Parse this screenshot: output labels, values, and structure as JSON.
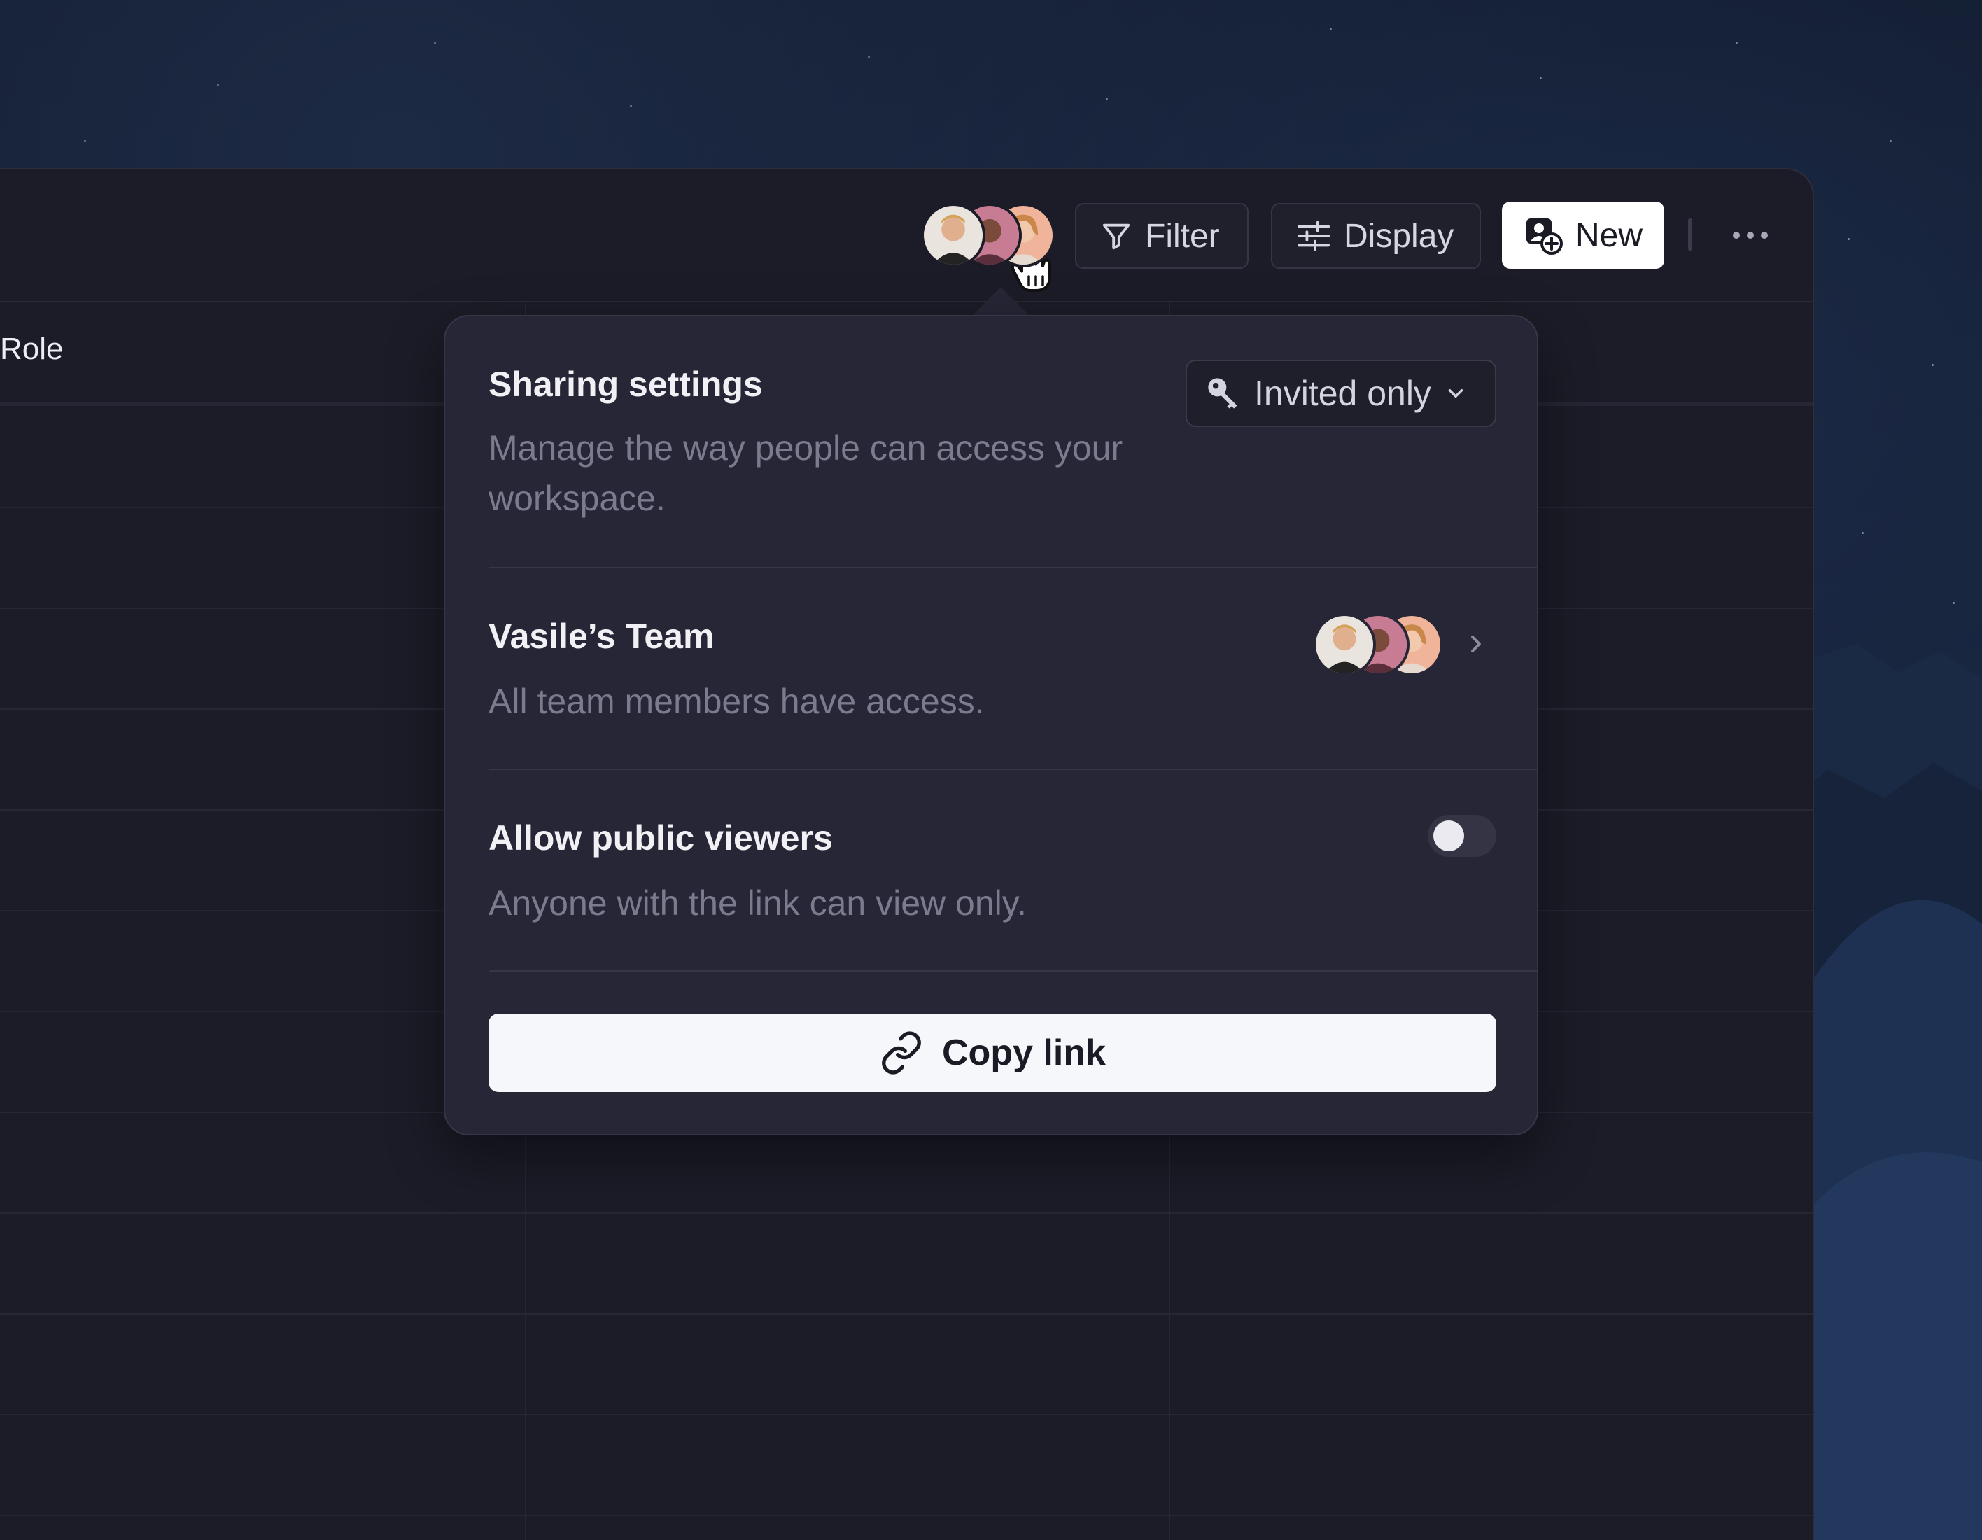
{
  "toolbar": {
    "filter_label": "Filter",
    "display_label": "Display",
    "new_label": "New"
  },
  "table": {
    "role_header": "Role"
  },
  "sharing": {
    "title": "Sharing settings",
    "description": "Manage the way people can access your workspace.",
    "access_value": "Invited only"
  },
  "team": {
    "title": "Vasile’s Team",
    "description": "All team members have access."
  },
  "public_viewers": {
    "title": "Allow public viewers",
    "description": "Anyone with the link can view only.",
    "enabled": false
  },
  "copy_link": {
    "label": "Copy link"
  },
  "colors": {
    "window_bg": "#1c1c28",
    "popover_bg": "#262636",
    "primary_button": "#ffffff",
    "muted_text": "#7b7b8f"
  },
  "icons": [
    "filter-icon",
    "display-sliders-icon",
    "new-user-icon",
    "more-icon",
    "key-icon",
    "chevron-down-icon",
    "chevron-right-icon",
    "link-icon",
    "hand-cursor-icon"
  ]
}
